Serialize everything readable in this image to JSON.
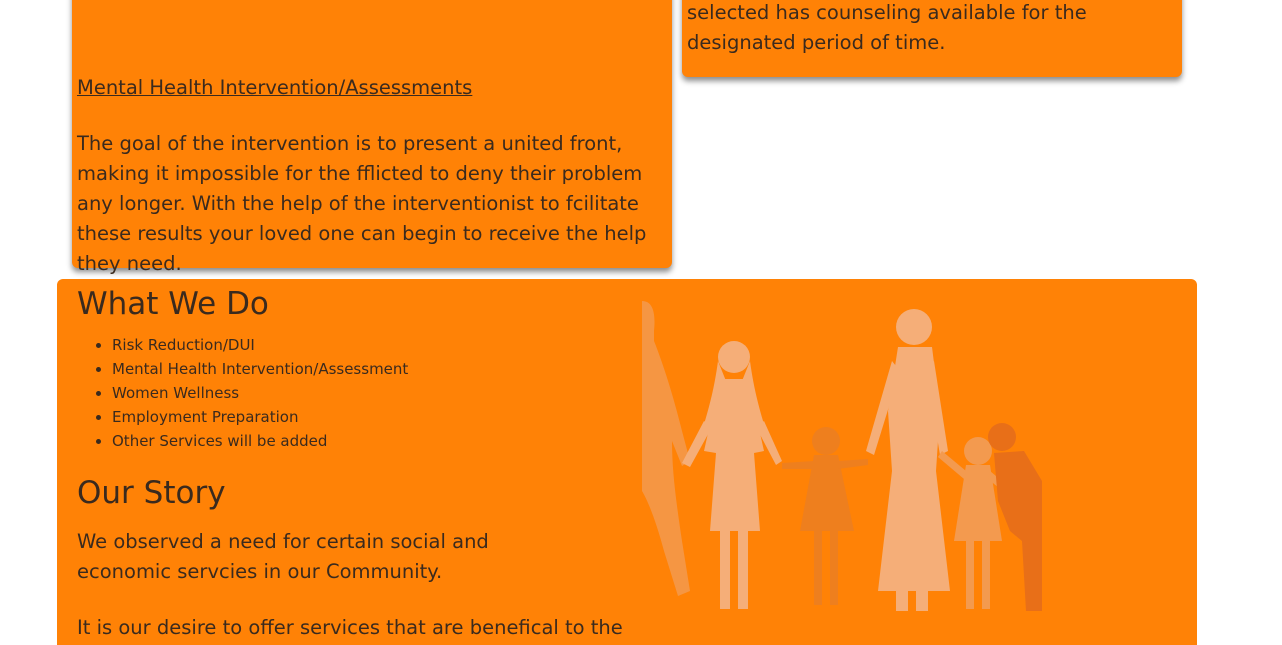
{
  "top_right_card": {
    "text": "selected has counseling available for the designated period of time."
  },
  "top_left_card": {
    "intervention_title": "Mental Health Intervention/Assessments",
    "intervention_body": "The goal of the intervention is to present a united front, making it impossible for the fflicted to deny their problem any longer. With the help of the interventionist to fcilitate these results your loved one can begin to receive the help they need."
  },
  "what_we_do": {
    "title": "What We Do",
    "services": [
      "Risk Reduction/DUI",
      "Mental Health Intervention/Assessment",
      "Women Wellness",
      "Employment Preparation",
      "Other Services will be added"
    ]
  },
  "our_story": {
    "title": "Our Story",
    "paragraph_1": "We observed a need for certain social and economic servcies in our Community.",
    "paragraph_2": "It is our desire to offer services that are benefical to the"
  },
  "colors": {
    "card_background": "#ff8206",
    "text": "#3a2a1e",
    "page_background": "#ffffff"
  },
  "image": {
    "name": "family-silhouette-image"
  }
}
